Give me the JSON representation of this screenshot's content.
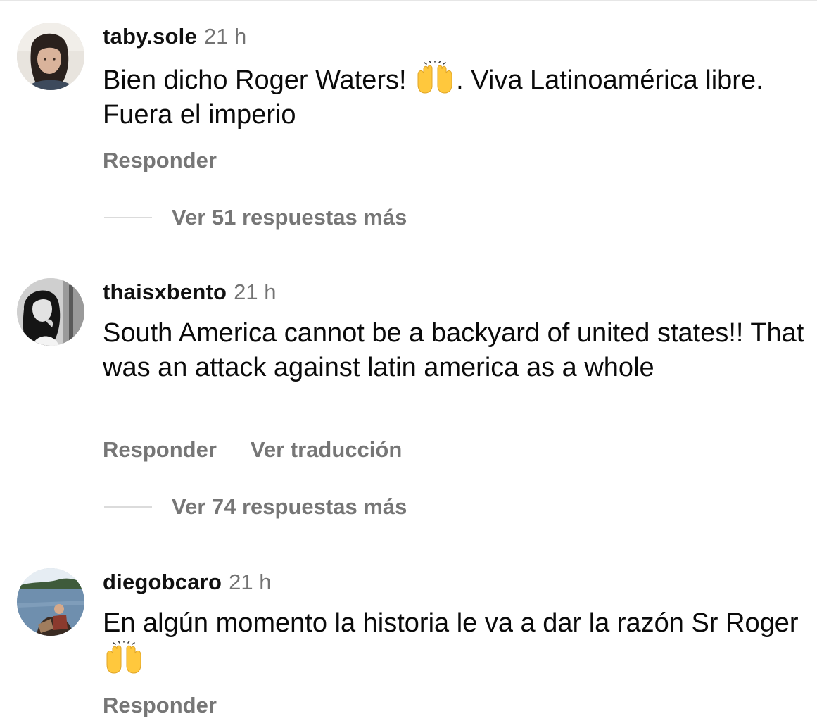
{
  "comments": [
    {
      "username": "taby.sole",
      "timestamp": "21 h",
      "avatar_icon": "user-avatar-woman-dark-hair",
      "text_part1": "Bien dicho Roger Waters! ",
      "emoji": "raising-hands-emoji",
      "text_part2": ". Viva Latinoamérica libre. Fuera el imperio",
      "reply_label": "Responder",
      "view_replies_label": "Ver 51 respuestas más"
    },
    {
      "username": "thaisxbento",
      "timestamp": "21 h",
      "avatar_icon": "user-avatar-bw-portrait",
      "text": "South America cannot be a backyard of united states!! That was an attack against latin america as a whole",
      "reply_label": "Responder",
      "translate_label": "Ver traducción",
      "view_replies_label": "Ver 74 respuestas más"
    },
    {
      "username": "diegobcaro",
      "timestamp": "21 h",
      "avatar_icon": "user-avatar-lake-landscape",
      "text_part1": "En algún momento la historia le va a dar la razón Sr Roger ",
      "emoji": "raising-hands-emoji",
      "reply_label": "Responder"
    }
  ],
  "colors": {
    "username": "#111111",
    "secondary_text": "#737373",
    "action_text": "#767676",
    "divider": "#dbdbdb",
    "emoji_yellow": "#FFC83D"
  }
}
